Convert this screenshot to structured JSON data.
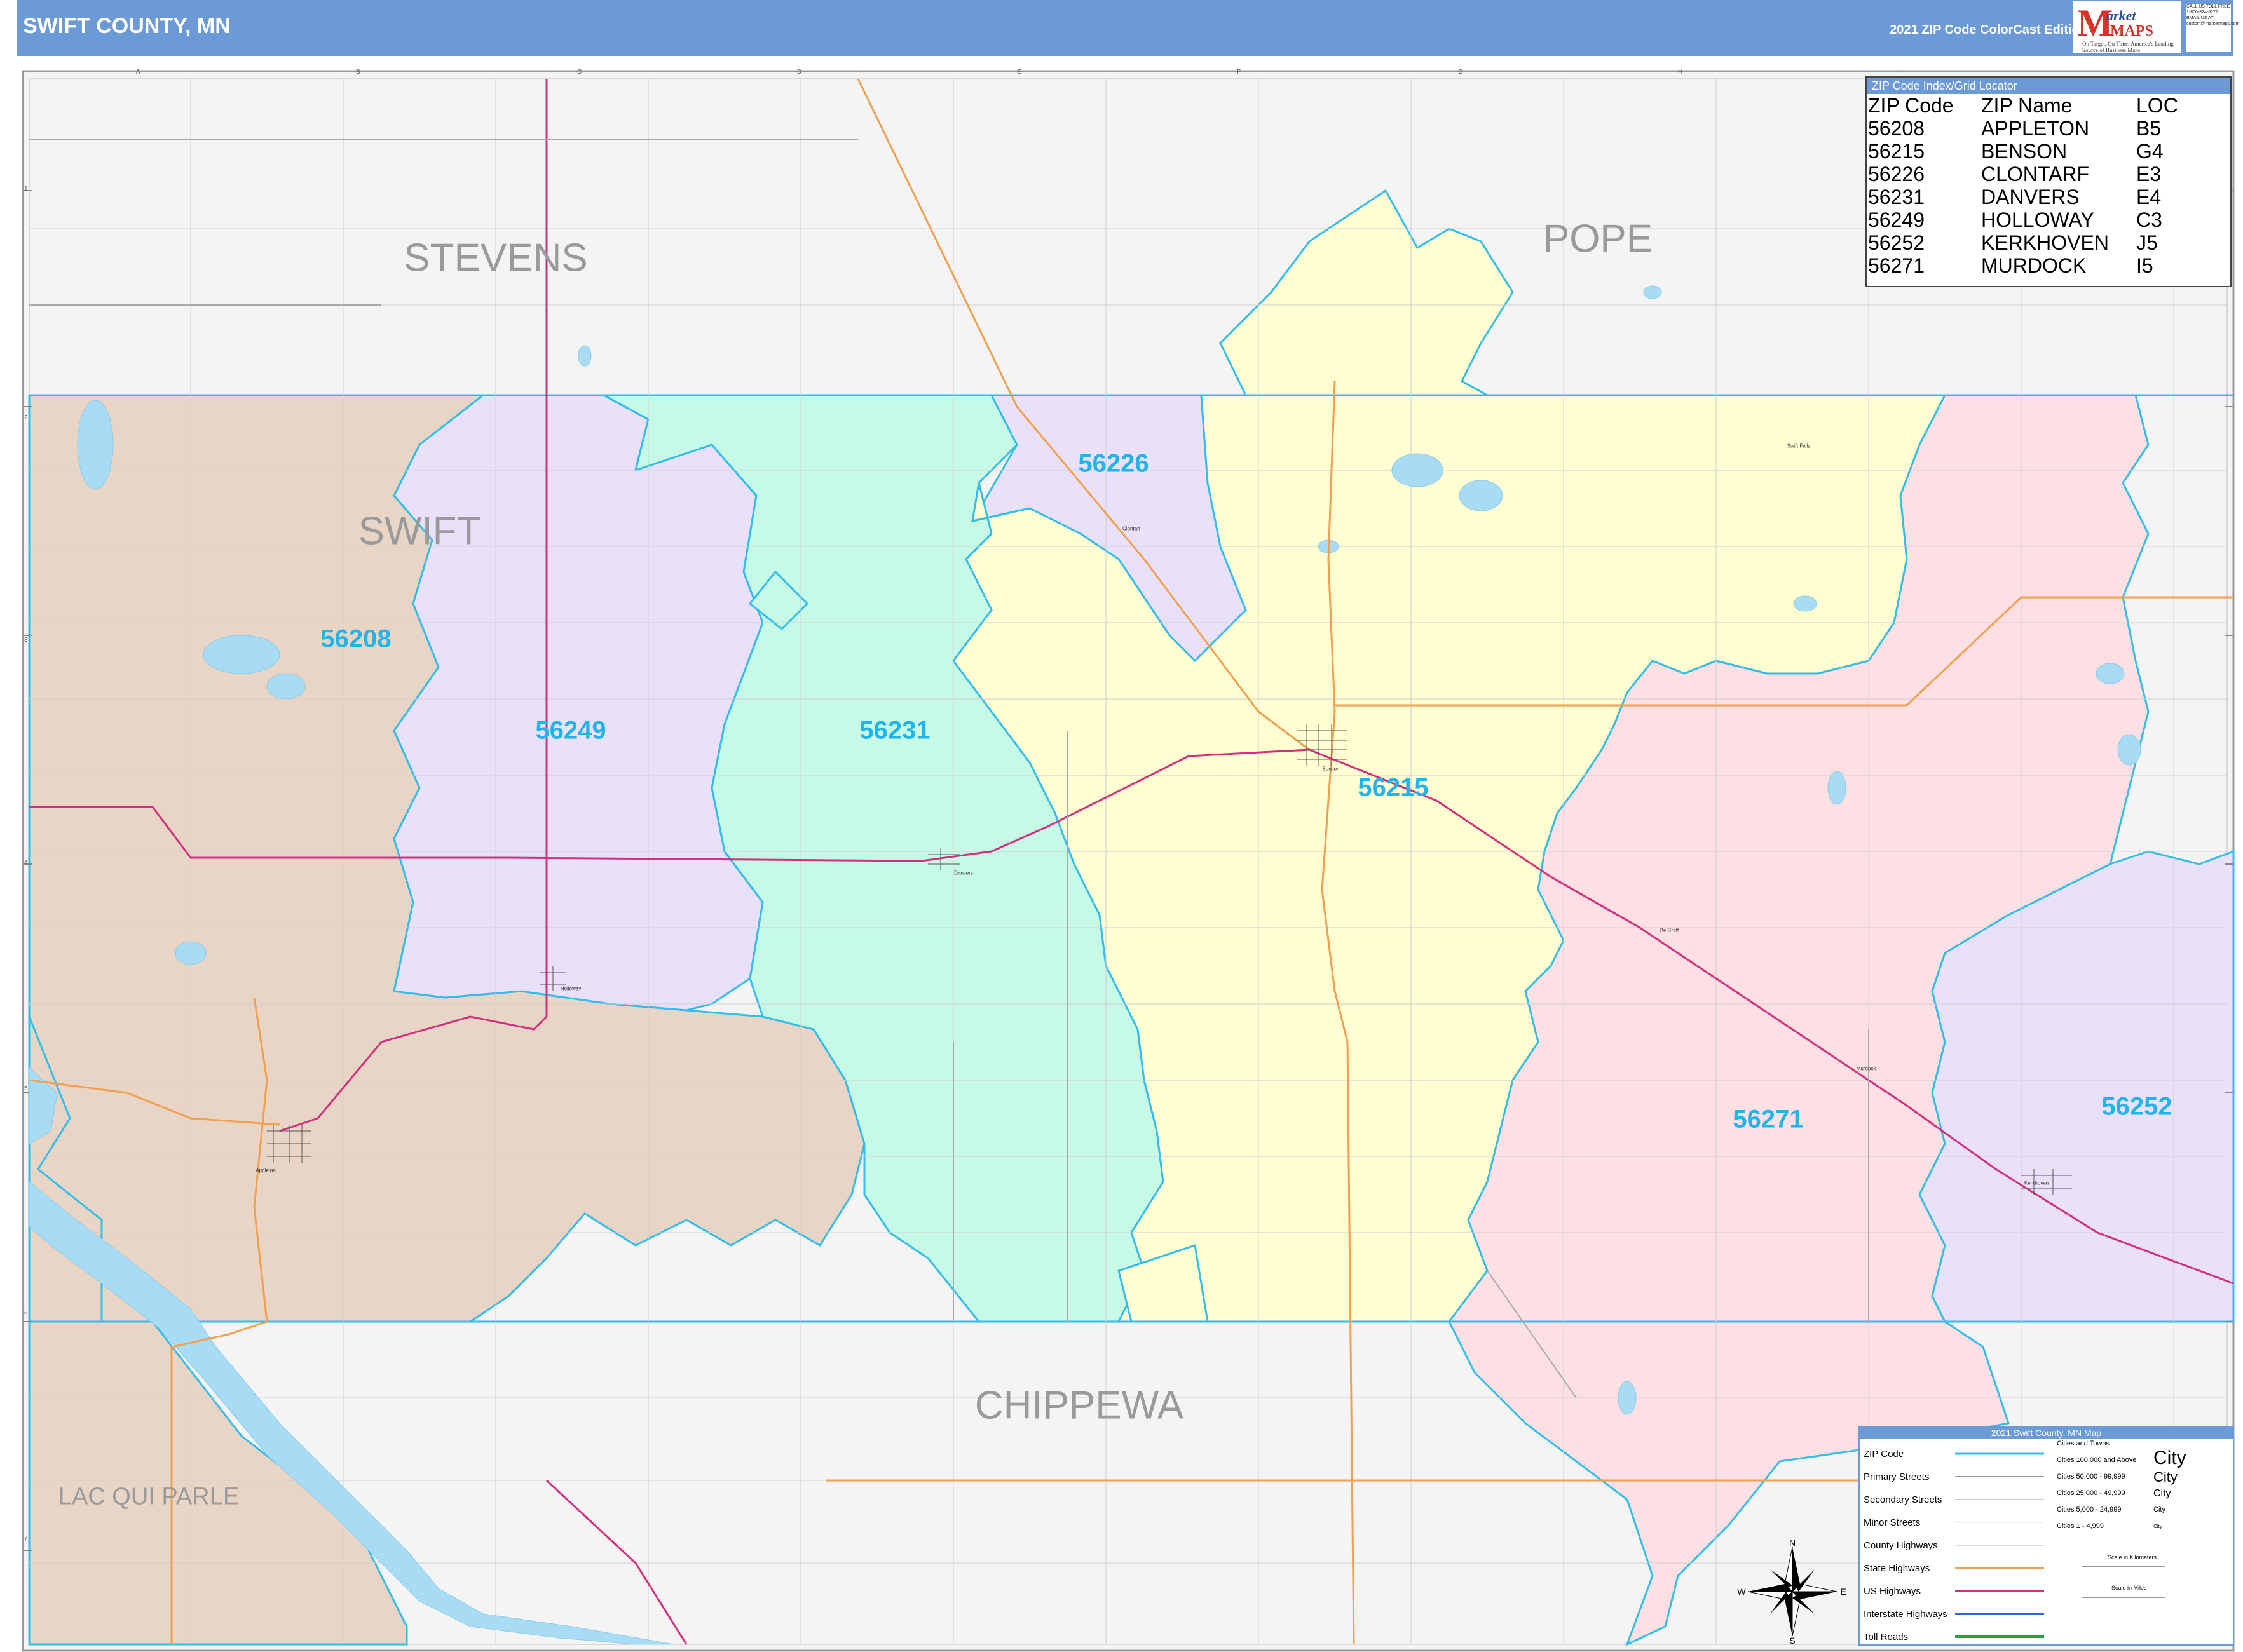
{
  "header": {
    "title": "SWIFT COUNTY, MN",
    "edition": "2021 ZIP Code ColorCast Edition",
    "logo_m": "M",
    "logo_arket": "arket",
    "logo_maps": "MAPS",
    "logo_tagline": "On Target, On Time. America's Leading Source of Business Maps",
    "contact_lines": [
      "CALL US TOLL FREE",
      "1-800-824-6277",
      "EMAIL US AT",
      "custom@marketmaps.com"
    ]
  },
  "counties": {
    "stevens": "STEVENS",
    "pope": "POPE",
    "swift": "SWIFT",
    "chippewa": "CHIPPEWA",
    "lac_qui_parle": "LAC QUI PARLE"
  },
  "zip_labels": {
    "z56208": "56208",
    "z56249": "56249",
    "z56231": "56231",
    "z56226": "56226",
    "z56215": "56215",
    "z56271": "56271",
    "z56252": "56252"
  },
  "towns": {
    "appleton": "Appleton",
    "holloway": "Holloway",
    "danvers": "Danvers",
    "clontarf": "Clontarf",
    "benson": "Benson",
    "de_graff": "De Graff",
    "murdock": "Murdock",
    "kerkhoven": "Kerkhoven",
    "swift_falls": "Swift Falls"
  },
  "grid": {
    "columns": [
      "A",
      "B",
      "C",
      "D",
      "E",
      "F",
      "G",
      "H",
      "I"
    ],
    "rows": [
      "1",
      "2",
      "3",
      "4",
      "5",
      "6",
      "7"
    ]
  },
  "zip_index": {
    "title": "ZIP Code Index/Grid Locator",
    "columns": [
      "ZIP Code",
      "ZIP Name",
      "LOC"
    ],
    "rows": [
      [
        "56208",
        "APPLETON",
        "B5"
      ],
      [
        "56215",
        "BENSON",
        "G4"
      ],
      [
        "56226",
        "CLONTARF",
        "E3"
      ],
      [
        "56231",
        "DANVERS",
        "E4"
      ],
      [
        "56249",
        "HOLLOWAY",
        "C3"
      ],
      [
        "56252",
        "KERKHOVEN",
        "J5"
      ],
      [
        "56271",
        "MURDOCK",
        "I5"
      ]
    ]
  },
  "legend": {
    "title": "2021 Swift County, MN Map",
    "items": [
      "ZIP Code",
      "Primary Streets",
      "Secondary Streets",
      "Minor Streets",
      "County Highways",
      "State Highways",
      "US Highways",
      "Interstate Highways",
      "Toll Roads"
    ],
    "cities_title": "Cities and Towns",
    "city_classes": [
      "Cities 100,000 and Above",
      "Cities 50,000 - 99,999",
      "Cities 25,000 - 49,999",
      "Cities 5,000 - 24,999",
      "Cities 1 - 4,999"
    ],
    "city_word": "City",
    "scale_km": "Scale in Kilometers",
    "scale_mi": "Scale in Miles"
  },
  "compass": {
    "n": "N",
    "s": "S",
    "e": "E",
    "w": "W"
  },
  "colors": {
    "header": "#6b9ad6",
    "zip_boundary": "#33bde8",
    "z56208": "#e8d5c6",
    "z56249": "#e9e0fa",
    "z56231": "#c6f9e6",
    "z56226": "#e9e0fa",
    "z56215": "#fefed2",
    "z56271": "#fde0e4",
    "z56252": "#e9e0fa",
    "outside": "#f4f4f4",
    "water": "#a8dcf5",
    "us_highway": "#d2307e",
    "state_highway": "#f0a050"
  }
}
